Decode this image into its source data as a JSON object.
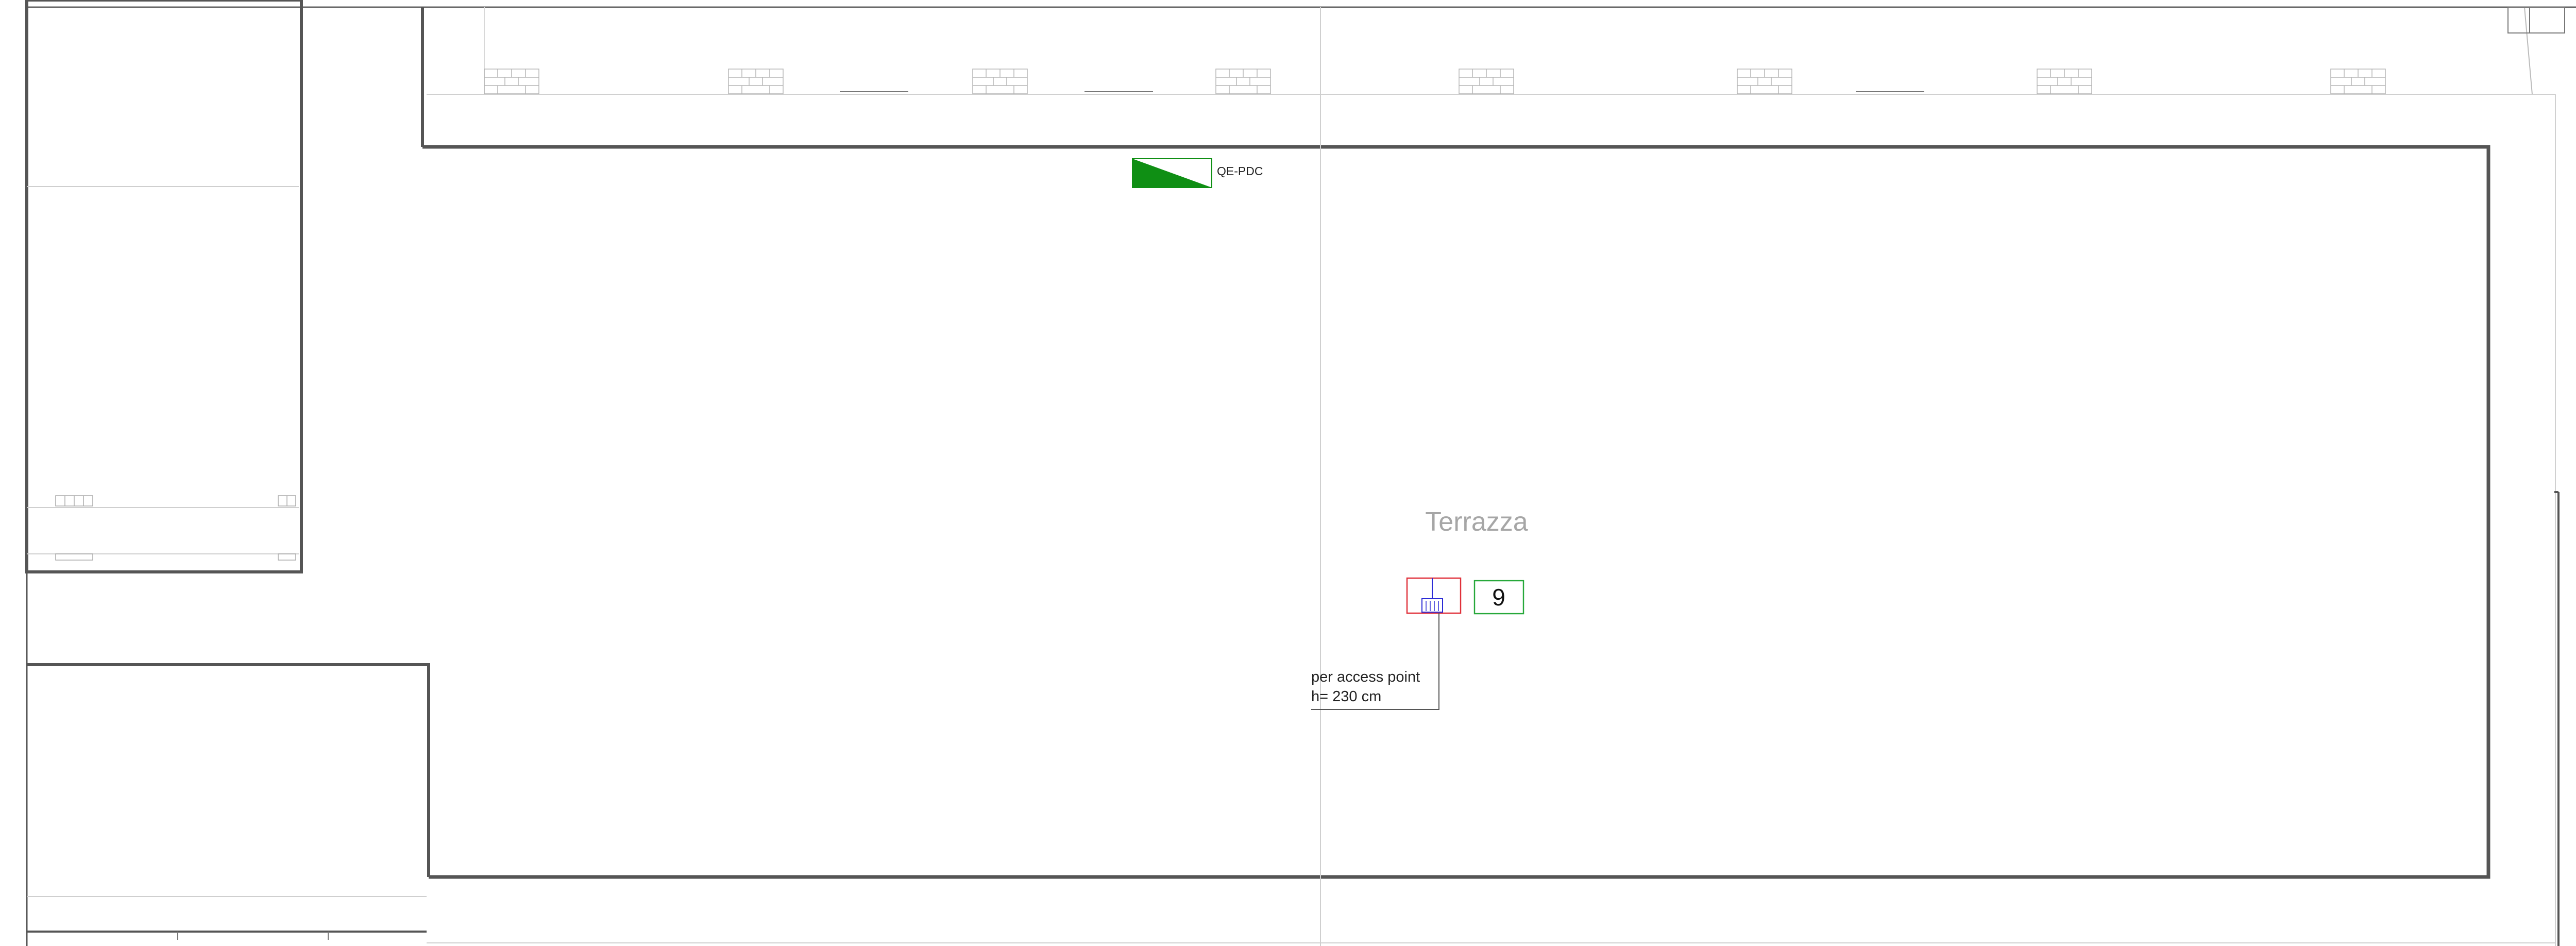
{
  "drawing": {
    "room_label": "Terrazza",
    "panel_label": "QE-PDC",
    "device_number": "9",
    "note_line1": "per access point",
    "note_line2": "h= 230 cm"
  },
  "colors": {
    "wall": "#4d4d4d",
    "thin_line": "#c8c8c8",
    "panel_fill": "#0f8f14",
    "device_box": "#e0313a",
    "device_symbol": "#2b2bd6",
    "number_box": "#27a83a"
  },
  "icons": [
    "electrical-panel-icon",
    "access-point-icon"
  ]
}
